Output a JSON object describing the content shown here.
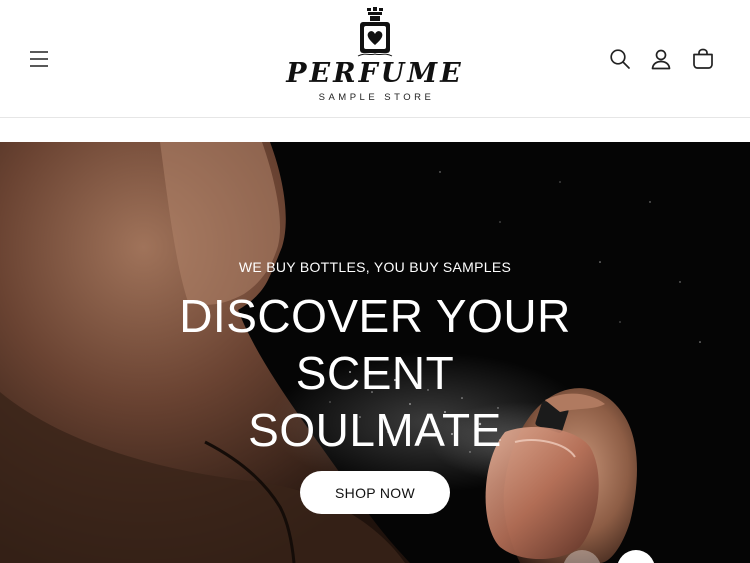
{
  "header": {
    "logo": {
      "wordmark": "PERFUME",
      "subtitle": "SAMPLE STORE"
    },
    "icons": {
      "menu": "menu-icon",
      "search": "search-icon",
      "account": "account-icon",
      "cart": "cart-icon"
    }
  },
  "hero": {
    "tagline": "WE BUY BOTTLES, YOU BUY SAMPLES",
    "title_line1": "DISCOVER YOUR SCENT",
    "title_line2": "SOULMATE",
    "cta_label": "SHOP NOW",
    "slide_controls": [
      "previous-slide",
      "next-slide"
    ]
  },
  "colors": {
    "header_bg": "#ffffff",
    "hero_bg": "#050505",
    "button_bg": "#ffffff",
    "text_dark": "#121212"
  }
}
